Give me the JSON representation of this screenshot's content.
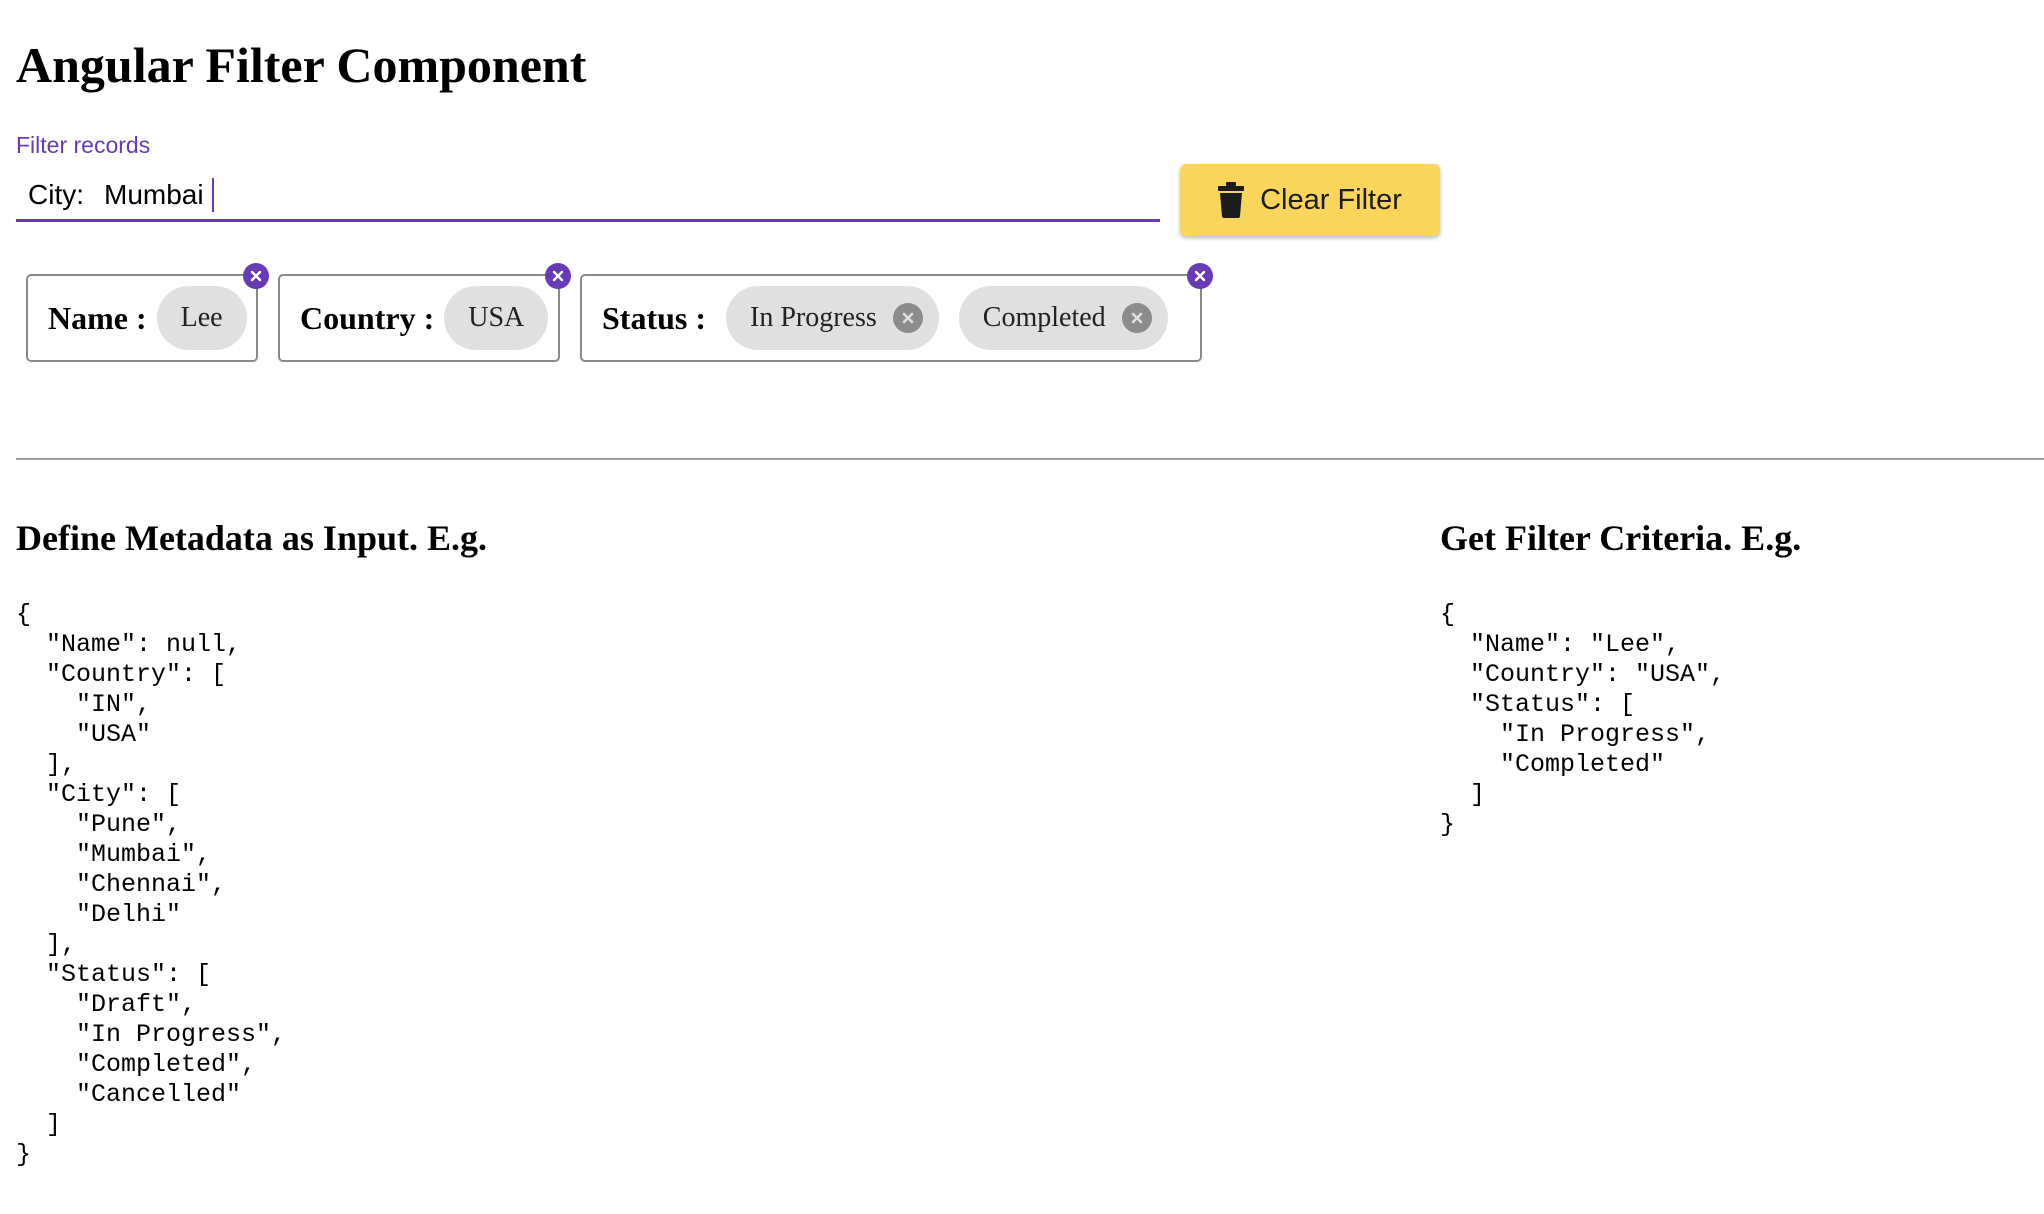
{
  "page": {
    "title": "Angular Filter Component"
  },
  "filter_input": {
    "label": "Filter records",
    "prefix": "City:",
    "value": "Mumbai"
  },
  "clear_button": {
    "label": "Clear Filter",
    "icon": "trash-icon",
    "color": "#fad55c"
  },
  "chip_groups": [
    {
      "label": "Name :",
      "chips": [
        "Lee"
      ]
    },
    {
      "label": "Country :",
      "chips": [
        "USA"
      ]
    },
    {
      "label": "Status :",
      "chips": [
        "In Progress",
        "Completed"
      ]
    }
  ],
  "metadata_section": {
    "heading": "Define Metadata as Input. E.g.",
    "json": "{\n  \"Name\": null,\n  \"Country\": [\n    \"IN\",\n    \"USA\"\n  ],\n  \"City\": [\n    \"Pune\",\n    \"Mumbai\",\n    \"Chennai\",\n    \"Delhi\"\n  ],\n  \"Status\": [\n    \"Draft\",\n    \"In Progress\",\n    \"Completed\",\n    \"Cancelled\"\n  ]\n}"
  },
  "criteria_section": {
    "heading": "Get Filter Criteria. E.g.",
    "json": "{\n  \"Name\": \"Lee\",\n  \"Country\": \"USA\",\n  \"Status\": [\n    \"In Progress\",\n    \"Completed\"\n  ]\n}"
  },
  "colors": {
    "accent": "#673ab7",
    "chip_background": "#e0e0e0",
    "chip_remove": "#8c8c8c"
  }
}
